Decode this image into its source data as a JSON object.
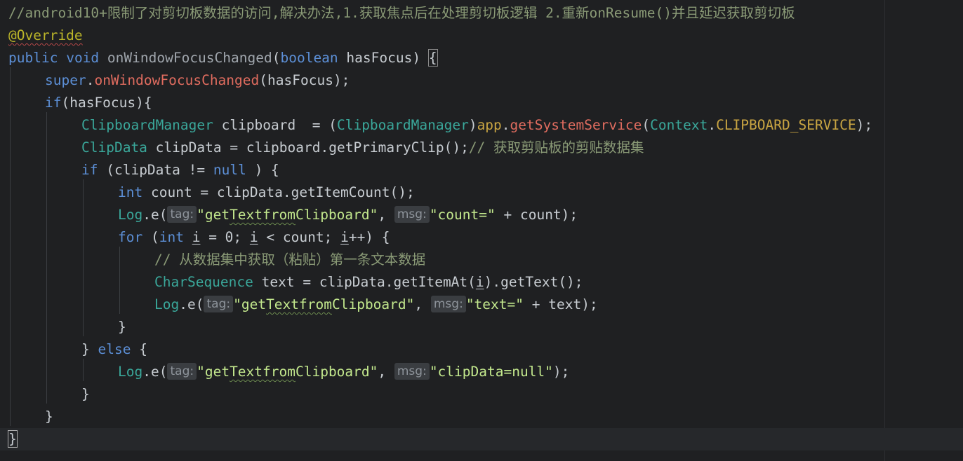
{
  "code": {
    "comment_top": "//android10+限制了对剪切板数据的访问,解决办法,1.获取焦点后在处理剪切板逻辑 2.重新onResume()并且延迟获取剪切板",
    "annotation": "@Override",
    "kw_public": "public",
    "kw_void": "void",
    "method_name": "onWindowFocusChanged",
    "kw_boolean": "boolean",
    "param_hasfocus": "hasFocus",
    "brace_open": "{",
    "brace_close": "}",
    "kw_super": "super",
    "super_method": "onWindowFocusChanged",
    "kw_if": "if",
    "if_cond": "(hasFocus){",
    "cls_clipboardmanager": "ClipboardManager",
    "var_clipboard": "clipboard",
    "cast_cls": "ClipboardManager",
    "app": "app",
    "get_system_service": "getSystemService",
    "cls_context": "Context",
    "fld_clipboard_service": "CLIPBOARD_SERVICE",
    "cls_clipdata": "ClipData",
    "var_clipdata": "clipData",
    "get_primary_clip": "clipboard.getPrimaryClip();",
    "comment_primary": "// 获取剪贴板的剪贴数据集",
    "kw_null": "null",
    "kw_int": "int",
    "var_count": "count",
    "get_item_count": "clipData.getItemCount();",
    "log_cls": "Log",
    "log_method": "e",
    "hint_tag": "tag:",
    "hint_msg": "msg:",
    "str_tag_prefix": "\"get",
    "str_tag_word": "Textfrom",
    "str_tag_suffix": "Clipboard\"",
    "str_count": "\"count=\"",
    "kw_for": "for",
    "var_i": "i",
    "comment_loop": "// 从数据集中获取（粘贴）第一条文本数据",
    "cls_charsequence": "CharSequence",
    "var_text": "text",
    "get_item_at": "clipData.getItemAt(",
    "get_text": ").getText();",
    "str_text": "\"text=\"",
    "kw_else": "else",
    "str_clipdata_null": "\"clipData=null\""
  }
}
